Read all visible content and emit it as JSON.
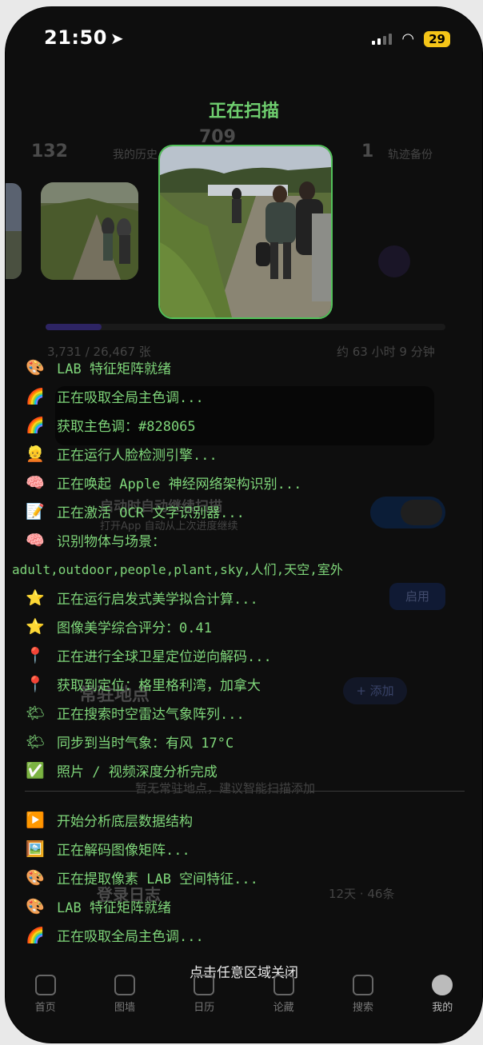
{
  "status": {
    "time": "21:50",
    "battery": "29"
  },
  "scan": {
    "title": "正在扫描",
    "close_hint": "点击任意区域关闭"
  },
  "log_lines": [
    {
      "icon": "palette",
      "emoji": "🎨",
      "text": "LAB 特征矩阵就绪"
    },
    {
      "icon": "rainbow",
      "emoji": "🌈",
      "text": "正在吸取全局主色调..."
    },
    {
      "icon": "rainbow",
      "emoji": "🌈",
      "text": "获取主色调：#828065"
    },
    {
      "icon": "face",
      "emoji": "👱",
      "text": "正在运行人脸检测引擎..."
    },
    {
      "icon": "brain",
      "emoji": "🧠",
      "text": "正在唤起 Apple 神经网络架构识别..."
    },
    {
      "icon": "memo",
      "emoji": "📝",
      "text": "正在激活 OCR 文字识别器..."
    },
    {
      "icon": "brain",
      "emoji": "🧠",
      "text": "识别物体与场景："
    },
    {
      "icon": "star",
      "emoji": "⭐",
      "text": "正在运行启发式美学拟合计算..."
    },
    {
      "icon": "star",
      "emoji": "⭐",
      "text": "图像美学综合评分：0.41"
    },
    {
      "icon": "pin",
      "emoji": "📍",
      "text": "正在进行全球卫星定位逆向解码..."
    },
    {
      "icon": "pin",
      "emoji": "📍",
      "text": "获取到定位：格里格利湾，加拿大"
    },
    {
      "icon": "sun-cloud",
      "emoji": "🌤",
      "text": "正在搜索时空雷达气象阵列..."
    },
    {
      "icon": "sun-cloud",
      "emoji": "🌤",
      "text": "同步到当时气象：有风 17°C"
    },
    {
      "icon": "check",
      "emoji": "✅",
      "text": "照片 / 视频深度分析完成"
    },
    {
      "icon": "play",
      "emoji": "▶️",
      "text": "开始分析底层数据结构"
    },
    {
      "icon": "picture",
      "emoji": "🖼️",
      "text": "正在解码图像矩阵..."
    },
    {
      "icon": "palette",
      "emoji": "🎨",
      "text": "正在提取像素 LAB 空间特征..."
    },
    {
      "icon": "palette",
      "emoji": "🎨",
      "text": "LAB 特征矩阵就绪"
    },
    {
      "icon": "rainbow",
      "emoji": "🌈",
      "text": "正在吸取全局主色调..."
    }
  ],
  "scene_tags": "adult,outdoor,people,plant,sky,人们,天空,室外",
  "background": {
    "stat_count_1": "132",
    "stat_label_1": "我的历史",
    "stat_count_2": "709",
    "stat_count_3": "1",
    "stat_label_3": "轨迹备份",
    "progress": "3,731 / 26,467 张",
    "eta": "约 63 小时 9 分钟",
    "auto_resume": "启动时自动继续扫描",
    "auto_resume_sub": "打开App 自动从上次进度继续",
    "enable_btn": "启用",
    "places_title": "常驻地点",
    "add_btn": "+ 添加",
    "places_empty": "暂无常驻地点，建议智能扫描添加",
    "log_title": "登录日志",
    "log_meta": "12天 · 46条"
  },
  "tabs": [
    {
      "label": "首页",
      "icon": "home-icon"
    },
    {
      "label": "图墙",
      "icon": "wall-icon"
    },
    {
      "label": "日历",
      "icon": "calendar-icon"
    },
    {
      "label": "论藏",
      "icon": "globe-icon"
    },
    {
      "label": "搜索",
      "icon": "search-icon"
    },
    {
      "label": "我的",
      "icon": "profile-icon"
    }
  ]
}
